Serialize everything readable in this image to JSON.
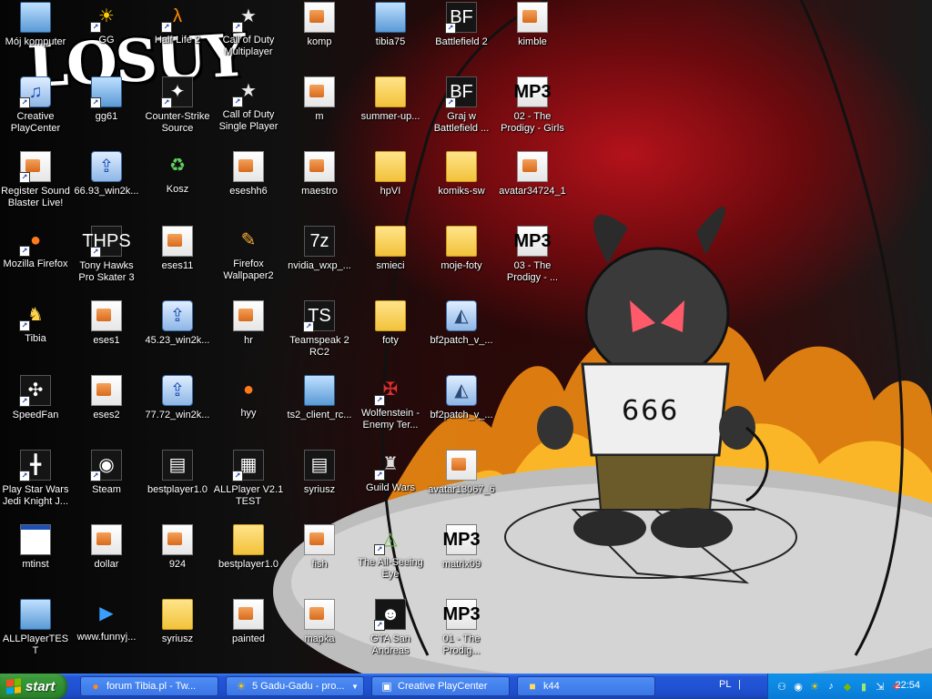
{
  "wallpaper": {
    "logo_text": "LOSUY",
    "shirt_text": "666"
  },
  "desktop": {
    "icons": [
      {
        "label": "Mój komputer",
        "icon": "my-computer-icon",
        "shortcut": false
      },
      {
        "label": "GG",
        "icon": "gadu-gadu-sun-icon",
        "shortcut": true
      },
      {
        "label": "Half-Life 2",
        "icon": "half-life-icon",
        "shortcut": true
      },
      {
        "label": "Call of Duty Multiplayer",
        "icon": "call-of-duty-star-icon",
        "shortcut": true
      },
      {
        "label": "komp",
        "icon": "image-document-icon",
        "shortcut": false
      },
      {
        "label": "tibia75",
        "icon": "setup-computer-icon",
        "shortcut": false
      },
      {
        "label": "Battlefield 2",
        "icon": "battlefield-icon",
        "shortcut": true
      },
      {
        "label": "kimble",
        "icon": "document-icon",
        "shortcut": false
      },
      {
        "label": "Creative PlayCenter",
        "icon": "creative-playcenter-icon",
        "shortcut": true
      },
      {
        "label": "gg61",
        "icon": "setup-computer-icon",
        "shortcut": true
      },
      {
        "label": "Counter-Strike Source",
        "icon": "counter-strike-icon",
        "shortcut": true
      },
      {
        "label": "Call of Duty Single Player",
        "icon": "call-of-duty-star-icon",
        "shortcut": true
      },
      {
        "label": "m",
        "icon": "image-document-icon",
        "shortcut": false
      },
      {
        "label": "summer-up...",
        "icon": "folder-icon",
        "shortcut": false
      },
      {
        "label": "Graj w Battlefield ...",
        "icon": "battlefield-icon",
        "shortcut": true
      },
      {
        "label": "02 - The Prodigy - Girls",
        "icon": "mp3-icon",
        "shortcut": false
      },
      {
        "label": "Register Sound Blaster Live!",
        "icon": "register-pen-icon",
        "shortcut": true
      },
      {
        "label": "66.93_win2k...",
        "icon": "driver-installer-icon",
        "shortcut": false
      },
      {
        "label": "Kosz",
        "icon": "recycle-bin-icon",
        "shortcut": false
      },
      {
        "label": "eseshh6",
        "icon": "image-document-icon",
        "shortcut": false
      },
      {
        "label": "maestro",
        "icon": "image-document-icon",
        "shortcut": false
      },
      {
        "label": "hpVI",
        "icon": "folder-icon",
        "shortcut": false
      },
      {
        "label": "komiks-sw",
        "icon": "folder-icon",
        "shortcut": false
      },
      {
        "label": "avatar34724_1",
        "icon": "png-image-icon",
        "shortcut": false
      },
      {
        "label": "Mozilla Firefox",
        "icon": "firefox-icon",
        "shortcut": true
      },
      {
        "label": "Tony Hawks Pro Skater 3",
        "icon": "tony-hawk-icon",
        "shortcut": true
      },
      {
        "label": "eses11",
        "icon": "image-document-icon",
        "shortcut": false
      },
      {
        "label": "Firefox Wallpaper2",
        "icon": "paint-brush-icon",
        "shortcut": false
      },
      {
        "label": "nvidia_wxp_...",
        "icon": "7zip-icon",
        "shortcut": false
      },
      {
        "label": "smieci",
        "icon": "folder-icon",
        "shortcut": false
      },
      {
        "label": "moje-foty",
        "icon": "folder-icon",
        "shortcut": false
      },
      {
        "label": "03 - The Prodigy - ...",
        "icon": "mp3-icon",
        "shortcut": false
      },
      {
        "label": "Tibia",
        "icon": "tibia-knight-icon",
        "shortcut": true
      },
      {
        "label": "eses1",
        "icon": "image-document-icon",
        "shortcut": false
      },
      {
        "label": "45.23_win2k...",
        "icon": "driver-installer-icon",
        "shortcut": false
      },
      {
        "label": "hr",
        "icon": "image-document-icon",
        "shortcut": false
      },
      {
        "label": "Teamspeak 2 RC2",
        "icon": "teamspeak-icon",
        "shortcut": true
      },
      {
        "label": "foty",
        "icon": "folder-icon",
        "shortcut": false
      },
      {
        "label": "bf2patch_v_...",
        "icon": "battlefield-patch-icon",
        "shortcut": false
      },
      {
        "label": "SpeedFan",
        "icon": "speedfan-icon",
        "shortcut": true
      },
      {
        "label": "eses2",
        "icon": "image-document-icon",
        "shortcut": false
      },
      {
        "label": "77.72_win2k...",
        "icon": "driver-installer-icon",
        "shortcut": false
      },
      {
        "label": "hyy",
        "icon": "firefox-icon",
        "shortcut": false
      },
      {
        "label": "ts2_client_rc...",
        "icon": "setup-computer-icon",
        "shortcut": false
      },
      {
        "label": "Wolfenstein - Enemy Ter...",
        "icon": "wolfenstein-icon",
        "shortcut": true
      },
      {
        "label": "bf2patch_v_...",
        "icon": "battlefield-patch-icon",
        "shortcut": false
      },
      {
        "label": "Play Star Wars Jedi Knight J...",
        "icon": "lightsaber-icon",
        "shortcut": true
      },
      {
        "label": "Steam",
        "icon": "steam-icon",
        "shortcut": true
      },
      {
        "label": "bestplayer1.0",
        "icon": "winrar-archive-icon",
        "shortcut": false
      },
      {
        "label": "ALLPlayer V2.1 TEST",
        "icon": "film-strip-icon",
        "shortcut": true
      },
      {
        "label": "syriusz",
        "icon": "winrar-archive-icon",
        "shortcut": false
      },
      {
        "label": "Guild Wars",
        "icon": "guild-wars-icon",
        "shortcut": true
      },
      {
        "label": "avatar13067_6",
        "icon": "png-image-icon",
        "shortcut": false
      },
      {
        "label": "mtinst",
        "icon": "application-window-icon",
        "shortcut": false
      },
      {
        "label": "dollar",
        "icon": "image-document-icon",
        "shortcut": false
      },
      {
        "label": "924",
        "icon": "png-image-icon",
        "shortcut": false
      },
      {
        "label": "bestplayer1.0",
        "icon": "folder-icon",
        "shortcut": false
      },
      {
        "label": "fish",
        "icon": "image-document-icon",
        "shortcut": false
      },
      {
        "label": "The All-Seeing Eye",
        "icon": "all-seeing-eye-icon",
        "shortcut": true
      },
      {
        "label": "matrix09",
        "icon": "mp3-icon",
        "shortcut": false
      },
      {
        "label": "ALLPlayerTEST",
        "icon": "setup-computer-icon",
        "shortcut": false
      },
      {
        "label": "www.funnyj...",
        "icon": "media-player-icon",
        "shortcut": false
      },
      {
        "label": "syriusz",
        "icon": "folder-icon",
        "shortcut": false
      },
      {
        "label": "painted",
        "icon": "image-document-icon",
        "shortcut": false
      },
      {
        "label": "mapka",
        "icon": "image-document-icon",
        "shortcut": false
      },
      {
        "label": "GTA San Andreas",
        "icon": "gta-san-andreas-icon",
        "shortcut": true
      },
      {
        "label": "01 - The Prodig...",
        "icon": "mp3-icon",
        "shortcut": false
      }
    ]
  },
  "taskbar": {
    "start_label": "start",
    "tasks": [
      {
        "label": "forum Tibia.pl - Tw...",
        "icon": "firefox-icon"
      },
      {
        "label": "5 Gadu-Gadu - pro...",
        "icon": "gadu-gadu-sun-icon"
      },
      {
        "label": "Creative PlayCenter",
        "icon": "creative-playcenter-icon"
      },
      {
        "label": "k44",
        "icon": "folder-icon"
      }
    ],
    "language": "PL",
    "language_separator": "|",
    "tray_icons": [
      "network-icon",
      "steam-icon",
      "gadu-gadu-sun-icon",
      "speaker-icon",
      "nvidia-icon",
      "battery-icon",
      "safely-remove-icon",
      "antivirus-icon"
    ],
    "clock": "22:54"
  }
}
